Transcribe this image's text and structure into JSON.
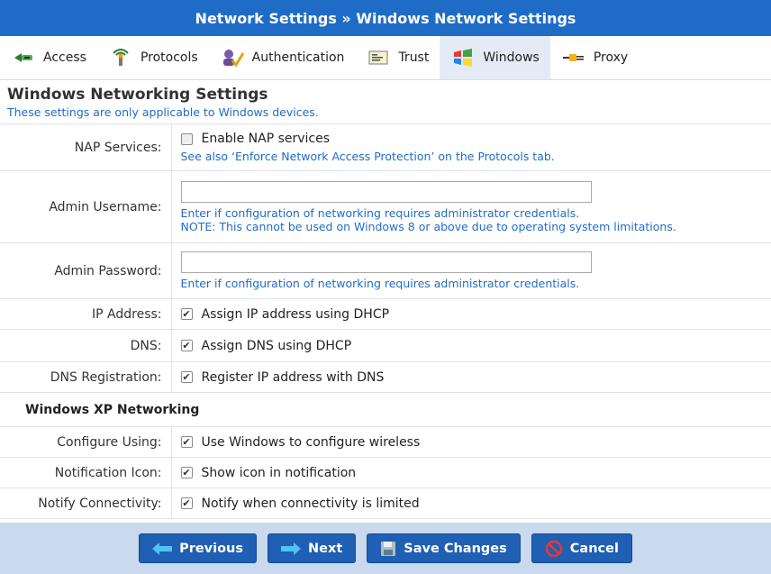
{
  "header": {
    "title": "Network Settings » Windows Network Settings"
  },
  "tabs": [
    {
      "label": "Access",
      "icon": "access-icon"
    },
    {
      "label": "Protocols",
      "icon": "protocols-icon"
    },
    {
      "label": "Authentication",
      "icon": "authentication-icon"
    },
    {
      "label": "Trust",
      "icon": "trust-icon"
    },
    {
      "label": "Windows",
      "icon": "windows-icon",
      "active": true
    },
    {
      "label": "Proxy",
      "icon": "proxy-icon"
    }
  ],
  "section": {
    "title": "Windows Networking Settings",
    "subtitle": "These settings are only applicable to Windows devices."
  },
  "fields": {
    "nap": {
      "label": "NAP Services:",
      "checkbox_label": "Enable NAP services",
      "checked": false,
      "hint": "See also ‘Enforce Network Access Protection’ on the Protocols tab."
    },
    "admin_username": {
      "label": "Admin Username:",
      "value": "",
      "hint1": "Enter if configuration of networking requires administrator credentials.",
      "hint2": "NOTE: This cannot be used on Windows 8 or above due to operating system limitations."
    },
    "admin_password": {
      "label": "Admin Password:",
      "value": "",
      "hint": "Enter if configuration of networking requires administrator credentials."
    },
    "ip_address": {
      "label": "IP Address:",
      "checkbox_label": "Assign IP address using DHCP",
      "checked": true
    },
    "dns": {
      "label": "DNS:",
      "checkbox_label": "Assign DNS using DHCP",
      "checked": true
    },
    "dns_registration": {
      "label": "DNS Registration:",
      "checkbox_label": "Register IP address with DNS",
      "checked": true
    }
  },
  "xp": {
    "heading": "Windows XP Networking",
    "configure_using": {
      "label": "Configure Using:",
      "checkbox_label": "Use Windows to configure wireless",
      "checked": true
    },
    "notification_icon": {
      "label": "Notification Icon:",
      "checkbox_label": "Show icon in notification",
      "checked": true
    },
    "notify_connectivity": {
      "label": "Notify Connectivity:",
      "checkbox_label": "Notify when connectivity is limited",
      "checked": true
    }
  },
  "footer": {
    "previous": "Previous",
    "next": "Next",
    "save": "Save Changes",
    "cancel": "Cancel"
  },
  "colors": {
    "header": "#1f6cc7",
    "hint": "#1f6cc7",
    "footer_bg": "#c9d9ee",
    "button": "#1f5fb4"
  }
}
